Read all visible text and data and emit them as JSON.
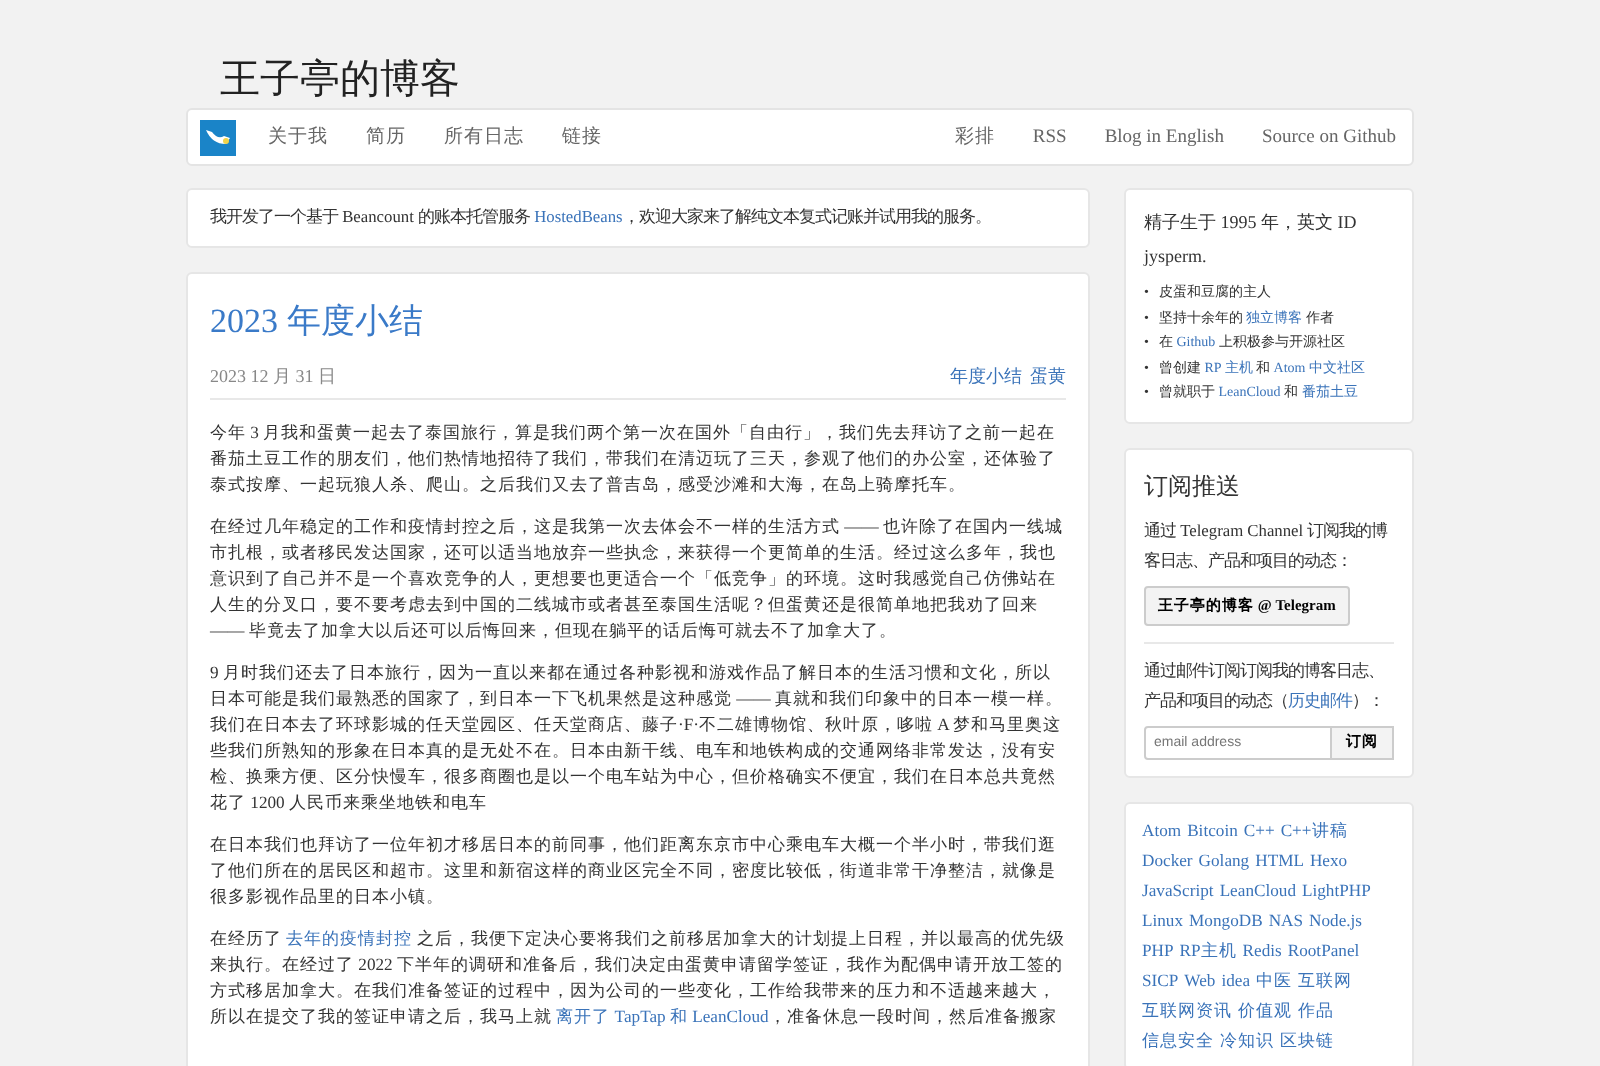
{
  "site_title": "王子亭的博客",
  "nav": {
    "left": [
      "关于我",
      "简历",
      "所有日志",
      "链接"
    ],
    "right": [
      "彩排",
      "RSS",
      "Blog in English",
      "Source on Github"
    ]
  },
  "notice": [
    {
      "kind": "text",
      "text": "我开发了一个基于 Beancount 的账本托管服务 "
    },
    {
      "kind": "link",
      "text": "HostedBeans"
    },
    {
      "kind": "text",
      "text": "，欢迎大家来了解纯文本复式记账并试用我的服务。"
    }
  ],
  "post": {
    "title": "2023 年度小结",
    "date": "2023 12 月 31 日",
    "tags": [
      "年度小结",
      "蛋黄"
    ],
    "paragraphs": [
      [
        {
          "kind": "text",
          "text": "今年 3 月我和蛋黄一起去了泰国旅行，算是我们两个第一次在国外「自由行」，我们先去拜访了之前一起在番茄土豆工作的朋友们，他们热情地招待了我们，带我们在清迈玩了三天，参观了他们的办公室，还体验了泰式按摩、一起玩狼人杀、爬山。之后我们又去了普吉岛，感受沙滩和大海，在岛上骑摩托车。"
        }
      ],
      [
        {
          "kind": "text",
          "text": "在经过几年稳定的工作和疫情封控之后，这是我第一次去体会不一样的生活方式 —— 也许除了在国内一线城市扎根，或者移民发达国家，还可以适当地放弃一些执念，来获得一个更简单的生活。经过这么多年，我也意识到了自己并不是一个喜欢竞争的人，更想要也更适合一个「低竞争」的环境。这时我感觉自己仿佛站在人生的分叉口，要不要考虑去到中国的二线城市或者甚至泰国生活呢？但蛋黄还是很简单地把我劝了回来 —— 毕竟去了加拿大以后还可以后悔回来，但现在躺平的话后悔可就去不了加拿大了。"
        }
      ],
      [
        {
          "kind": "text",
          "text": "9 月时我们还去了日本旅行，因为一直以来都在通过各种影视和游戏作品了解日本的生活习惯和文化，所以日本可能是我们最熟悉的国家了，到日本一下飞机果然是这种感觉 —— 真就和我们印象中的日本一模一样。我们在日本去了环球影城的任天堂园区、任天堂商店、藤子·F·不二雄博物馆、秋叶原，哆啦 A 梦和马里奥这些我们所熟知的形象在日本真的是无处不在。日本由新干线、电车和地铁构成的交通网络非常发达，没有安检、换乘方便、区分快慢车，很多商圈也是以一个电车站为中心，但价格确实不便宜，我们在日本总共竟然花了 1200 人民币来乘坐地铁和电车"
        }
      ],
      [
        {
          "kind": "text",
          "text": "在日本我们也拜访了一位年初才移居日本的前同事，他们距离东京市中心乘电车大概一个半小时，带我们逛了他们所在的居民区和超市。这里和新宿这样的商业区完全不同，密度比较低，街道非常干净整洁，就像是很多影视作品里的日本小镇。"
        }
      ],
      [
        {
          "kind": "text",
          "text": "在经历了 "
        },
        {
          "kind": "link",
          "text": "去年的疫情封控"
        },
        {
          "kind": "text",
          "text": " 之后，我便下定决心要将我们之前移居加拿大的计划提上日程，并以最高的优先级来执行。在经过了 2022 下半年的调研和准备后，我们决定由蛋黄申请留学签证，我作为配偶申请开放工签的方式移居加拿大。在我们准备签证的过程中，因为公司的一些变化，工作给我带来的压力和不适越来越大，所以在提交了我的签证申请之后，我马上就 "
        },
        {
          "kind": "link",
          "text": "离开了 TapTap 和 LeanCloud"
        },
        {
          "kind": "text",
          "text": "，准备休息一段时间，然后准备搬家"
        }
      ]
    ]
  },
  "about": {
    "intro": "精子生于 1995 年，英文 ID jysperm.",
    "items": [
      {
        "bullet": "•",
        "parts": [
          {
            "kind": "text",
            "text": "皮蛋和豆腐的主人"
          }
        ]
      },
      {
        "bullet": "•",
        "parts": [
          {
            "kind": "text",
            "text": "坚持十余年的 "
          },
          {
            "kind": "link",
            "text": "独立博客"
          },
          {
            "kind": "text",
            "text": " 作者"
          }
        ]
      },
      {
        "bullet": "•",
        "parts": [
          {
            "kind": "text",
            "text": "在 "
          },
          {
            "kind": "link",
            "text": "Github"
          },
          {
            "kind": "text",
            "text": " 上积极参与开源社区"
          }
        ]
      },
      {
        "bullet": "•",
        "parts": [
          {
            "kind": "text",
            "text": "曾创建 "
          },
          {
            "kind": "link",
            "text": "RP 主机"
          },
          {
            "kind": "text",
            "text": " 和 "
          },
          {
            "kind": "link",
            "text": "Atom 中文社区"
          }
        ]
      },
      {
        "bullet": "•",
        "parts": [
          {
            "kind": "text",
            "text": "曾就职于 "
          },
          {
            "kind": "link",
            "text": "LeanCloud"
          },
          {
            "kind": "text",
            "text": " 和 "
          },
          {
            "kind": "link",
            "text": "番茄土豆"
          }
        ]
      }
    ]
  },
  "subscribe": {
    "title": "订阅推送",
    "telegram_text": "通过 Telegram Channel 订阅我的博客日志、产品和项目的动态：",
    "telegram_button": "王子亭的博客 @ Telegram",
    "email_text": [
      {
        "kind": "text",
        "text": "通过邮件订阅订阅我的博客日志、产品和项目的动态（"
      },
      {
        "kind": "link",
        "text": "历史邮件"
      },
      {
        "kind": "text",
        "text": "）："
      }
    ],
    "email_placeholder": "email address",
    "email_button": "订阅"
  },
  "tags": [
    "Atom",
    "Bitcoin",
    "C++",
    "C++讲稿",
    "Docker",
    "Golang",
    "HTML",
    "Hexo",
    "JavaScript",
    "LeanCloud",
    "LightPHP",
    "Linux",
    "MongoDB",
    "NAS",
    "Node.js",
    "PHP",
    "RP主机",
    "Redis",
    "RootPanel",
    "SICP",
    "Web",
    "idea",
    "中医",
    "互联网",
    "互联网资讯",
    "价值观",
    "作品",
    "信息安全",
    "冷知识",
    "区块链"
  ]
}
